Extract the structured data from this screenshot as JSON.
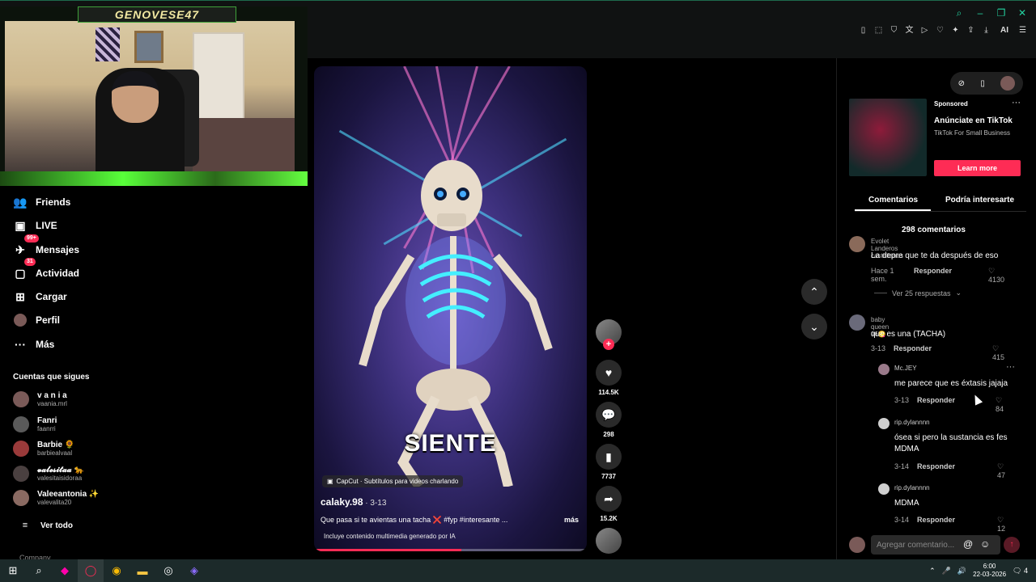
{
  "stream_overlay": {
    "streamer_name": "GENOVESE47"
  },
  "browser": {
    "window_controls": [
      "search-icon",
      "minimize-icon",
      "restore-icon",
      "close-icon"
    ],
    "extension_ai_label": "AI"
  },
  "sidebar": {
    "items": [
      {
        "label": "Friends",
        "icon": "friends-icon"
      },
      {
        "label": "LIVE",
        "icon": "live-icon"
      },
      {
        "label": "Mensajes",
        "icon": "messages-icon",
        "badge": "99+"
      },
      {
        "label": "Actividad",
        "icon": "activity-icon",
        "badge": "31"
      },
      {
        "label": "Cargar",
        "icon": "upload-icon"
      },
      {
        "label": "Perfil",
        "icon": "profile-icon"
      },
      {
        "label": "Más",
        "icon": "more-icon"
      }
    ],
    "following_title": "Cuentas que sigues",
    "following": [
      {
        "name": "v a n i a",
        "handle": "vaania.mrl"
      },
      {
        "name": "Fanri",
        "handle": "faanrri"
      },
      {
        "name": "Barbie 🌻",
        "handle": "barbiealvaal"
      },
      {
        "name": "𝓿𝓪𝓵𝓮𝓼𝓲𝓽𝓪𝓪 🐆",
        "handle": "valesitaisidoraa"
      },
      {
        "name": "Valeeantonia ✨",
        "handle": "valevalita20"
      }
    ],
    "see_all": "Ver todo",
    "company": "Company"
  },
  "video": {
    "caption_overlay": "SIENTE",
    "capcut_label": "CapCut · Subtítulos para videos charlando",
    "author": "calaky.98",
    "date": " · 3-13",
    "description": "Que pasa si te avientas una tacha ❌ #fyp #interesante ...",
    "more": "más",
    "ai_note": "Incluye contenido multimedia generado por IA",
    "progress_pct": 54
  },
  "actions": {
    "likes": "114.5K",
    "comments": "298",
    "saves": "7737",
    "shares": "15.2K"
  },
  "ad": {
    "sponsored": "Sponsored",
    "title": "Anúnciate en TikTok",
    "subtitle": "TikTok For Small Business",
    "cta": "Learn more"
  },
  "tabs": {
    "comments": "Comentarios",
    "suggested": "Podría interesarte"
  },
  "comments_panel": {
    "count": "298 comentarios",
    "comments": [
      {
        "user": "Evolet Landeros castellanos",
        "text": "La depre que te da después de eso",
        "time": "Hace 1 sem.",
        "reply": "Responder",
        "likes": "4130"
      },
      {
        "user": "baby queen 96😋",
        "text": "que es una (TACHA)",
        "time": "3-13",
        "reply": "Responder",
        "likes": "415"
      }
    ],
    "view_replies": "Ver 25 respuestas",
    "replies": [
      {
        "user": "Mc.JEY",
        "text": "me parece que es éxtasis jajaja",
        "time": "3-13",
        "reply": "Responder",
        "likes": "84"
      },
      {
        "user": "rip.dylannnn",
        "text": "ósea si pero la sustancia es fes MDMA",
        "time": "3-14",
        "reply": "Responder",
        "likes": "47"
      },
      {
        "user": "rip.dylannnn",
        "text": "MDMA",
        "time": "3-14",
        "reply": "Responder",
        "likes": "12"
      }
    ],
    "add_placeholder": "Agregar comentario..."
  },
  "taskbar": {
    "time": "6:00",
    "date": "22-03-2026",
    "notifications": "4"
  }
}
